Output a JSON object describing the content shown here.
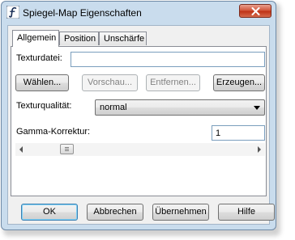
{
  "window": {
    "title": "Spiegel-Map Eigenschaften",
    "app_icon": "script-f-icon",
    "close_icon": "close-icon",
    "accent_close": "#c7432a"
  },
  "tabs": [
    {
      "label": "Allgemein",
      "active": true
    },
    {
      "label": "Position",
      "active": false
    },
    {
      "label": "Unschärfe",
      "active": false
    }
  ],
  "general": {
    "texture_file_label": "Texturdatei:",
    "texture_file_value": "",
    "choose_button": "Wählen...",
    "preview_button": "Vorschau...",
    "remove_button": "Entfernen...",
    "create_button": "Erzeugen...",
    "texture_quality_label": "Texturqualität:",
    "texture_quality_value": "normal",
    "gamma_label": "Gamma-Korrektur:",
    "gamma_value": "1",
    "gamma_slider_position": 0.15
  },
  "footer": {
    "ok": "OK",
    "cancel": "Abbrechen",
    "apply": "Übernehmen",
    "help": "Hilfe"
  }
}
